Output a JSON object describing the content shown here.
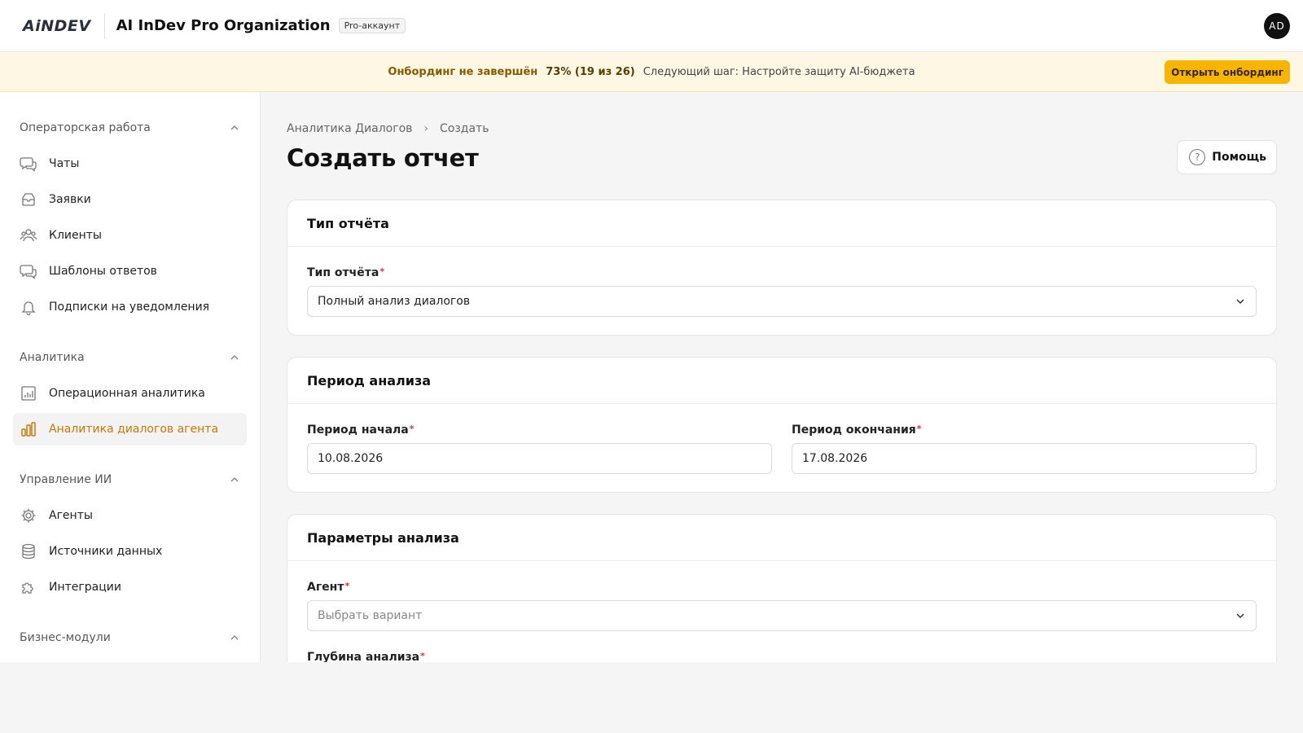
{
  "header": {
    "logo_text": "AiNDEV",
    "org_title": "AI InDev Pro Organization",
    "badge": "Pro-аккаунт",
    "avatar_initials": "AD"
  },
  "banner": {
    "status": "Онбординг не завершён",
    "progress": "73% (19 из 26)",
    "next_step": "Следующий шаг: Настройте защиту AI-бюджета",
    "button": "Открыть онбординг",
    "button_color": "#f7b500"
  },
  "sidebar": {
    "groups": [
      {
        "title": "Операторская работа",
        "items": [
          {
            "label": "Чаты",
            "icon": "chat-icon"
          },
          {
            "label": "Заявки",
            "icon": "inbox-icon"
          },
          {
            "label": "Клиенты",
            "icon": "users-icon"
          },
          {
            "label": "Шаблоны ответов",
            "icon": "chat-template-icon"
          },
          {
            "label": "Подписки на уведомления",
            "icon": "bell-icon"
          }
        ]
      },
      {
        "title": "Аналитика",
        "items": [
          {
            "label": "Операционная аналитика",
            "icon": "bar-chart-icon"
          },
          {
            "label": "Аналитика диалогов агента",
            "icon": "bar-chart-active-icon",
            "active": true
          }
        ]
      },
      {
        "title": "Управление ИИ",
        "items": [
          {
            "label": "Агенты",
            "icon": "gear-icon"
          },
          {
            "label": "Источники данных",
            "icon": "database-icon"
          },
          {
            "label": "Интеграции",
            "icon": "puzzle-icon"
          }
        ]
      },
      {
        "title": "Бизнес-модули",
        "items": []
      }
    ],
    "active_color": "#c8780a"
  },
  "main": {
    "breadcrumb": [
      "Аналитика Диалогов",
      "Создать"
    ],
    "title": "Создать отчет",
    "help_label": "Помощь",
    "cards": {
      "report_type": {
        "title": "Тип отчёта",
        "field_label": "Тип отчёта",
        "value": "Полный анализ диалогов"
      },
      "period": {
        "title": "Период анализа",
        "start_label": "Период начала",
        "start_value": "10.08.2026",
        "end_label": "Период окончания",
        "end_value": "17.08.2026"
      },
      "params": {
        "title": "Параметры анализа",
        "agent_label": "Агент",
        "agent_placeholder": "Выбрать вариант",
        "depth_label": "Глубина анализа"
      }
    }
  }
}
